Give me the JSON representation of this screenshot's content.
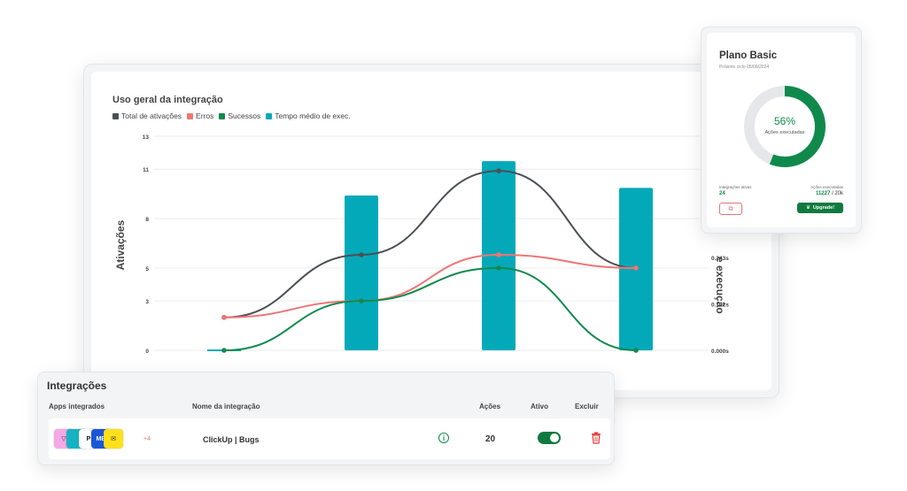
{
  "chart": {
    "title": "Uso geral da integração",
    "legend": [
      {
        "label": "Total de ativações",
        "color": "#4b4f54"
      },
      {
        "label": "Erros",
        "color": "#ef7575"
      },
      {
        "label": "Sucessos",
        "color": "#0f8a4c"
      },
      {
        "label": "Tempo médio de exec.",
        "color": "#04a9b9"
      }
    ],
    "y_left_title": "Ativações",
    "y_right_title": "e execução"
  },
  "chart_data": {
    "type": "line",
    "title": "Uso geral da integração",
    "ylabel": "Ativações",
    "y2label": "e execução",
    "yticks": [
      "0",
      "3",
      "5",
      "8",
      "11",
      "13"
    ],
    "y2ticks": [
      "0.000s",
      "0.122s",
      "0.243s"
    ],
    "ylim": [
      0,
      13
    ],
    "x": [
      0,
      1,
      2,
      3
    ],
    "series": [
      {
        "name": "Total de ativações",
        "type": "line",
        "color": "#4b4f54",
        "values": [
          2,
          5.8,
          10.9,
          5
        ]
      },
      {
        "name": "Erros",
        "type": "line",
        "color": "#ef7575",
        "values": [
          2,
          3,
          5.8,
          5
        ]
      },
      {
        "name": "Sucessos",
        "type": "line",
        "color": "#0f8a4c",
        "values": [
          0,
          3,
          5,
          0
        ]
      },
      {
        "name": "Tempo médio de exec.",
        "type": "bar",
        "color": "#04a9b9",
        "values": [
          0,
          0.405,
          0.495,
          0.425
        ]
      }
    ],
    "y2lim": [
      0,
      0.56
    ],
    "grid": true
  },
  "plan": {
    "title": "Plano Basic",
    "subtitle": "Próximo ciclo 05/09/2024",
    "percent": 56,
    "percent_label": "56%",
    "donut_caption": "Ações executadas",
    "integrations_label": "Integrações ativas",
    "integrations_value": "24",
    "actions_label": "Ações executadas",
    "actions_used": "11227",
    "actions_total": "/ 20k",
    "upgrade_label": "Upgrade!",
    "accent": "#0f8a4c"
  },
  "integrations": {
    "title": "Integrações",
    "headers": {
      "apps": "Apps integrados",
      "name": "Nome da integração",
      "actions": "Ações",
      "active": "Ativo",
      "delete": "Excluir"
    },
    "row": {
      "more_apps": "+4",
      "name": "ClickUp | Bugs",
      "actions": "20",
      "active": true
    },
    "apps": [
      {
        "icon": "triangle-app-icon",
        "bg": "#f4a9e6",
        "glyph": "▽",
        "fg": "#222"
      },
      {
        "icon": "teal-app-icon",
        "bg": "#16b3c4",
        "glyph": "",
        "fg": "#fff"
      },
      {
        "icon": "p-app-icon",
        "bg": "#ffffff",
        "glyph": "P",
        "fg": "#111"
      },
      {
        "icon": "blue-app-icon",
        "bg": "#1a56d8",
        "glyph": "MB",
        "fg": "#fff"
      },
      {
        "icon": "mailchimp-icon",
        "bg": "#ffe01b",
        "glyph": "✉",
        "fg": "#222"
      }
    ]
  }
}
